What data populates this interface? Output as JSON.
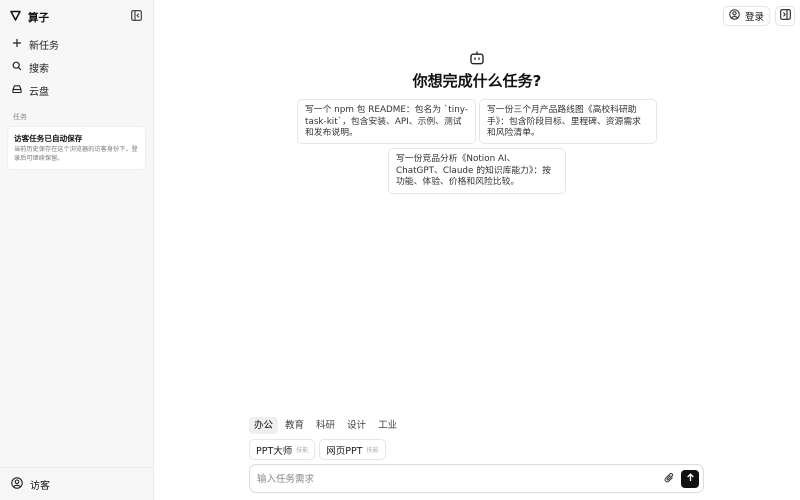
{
  "sidebar": {
    "brand": "算子",
    "nav": [
      {
        "label": "新任务",
        "icon": "plus-icon"
      },
      {
        "label": "搜索",
        "icon": "search-icon"
      },
      {
        "label": "云盘",
        "icon": "drive-icon"
      }
    ],
    "section_label": "任务",
    "history": {
      "title": "访客任务已自动保存",
      "desc": "当前历史保存在这个浏览器的访客身份下，登录后可继续保留。"
    },
    "footer_label": "访客"
  },
  "header": {
    "login_label": "登录"
  },
  "hero": {
    "title": "你想完成什么任务?",
    "suggestions": [
      "写一个 npm 包 README：包名为 `tiny-task-kit`，包含安装、API、示例、测试和发布说明。",
      "写一份三个月产品路线图《高校科研助手》：包含阶段目标、里程碑、资源需求和风险清单。",
      "写一份竞品分析《Notion AI、ChatGPT、Claude 的知识库能力》：按功能、体验、价格和风险比较。"
    ]
  },
  "composer": {
    "categories": [
      "办公",
      "教育",
      "科研",
      "设计",
      "工业"
    ],
    "chips": [
      {
        "label": "PPT大师",
        "tag": "技能"
      },
      {
        "label": "网页PPT",
        "tag": "技能"
      }
    ],
    "placeholder": "输入任务需求"
  }
}
